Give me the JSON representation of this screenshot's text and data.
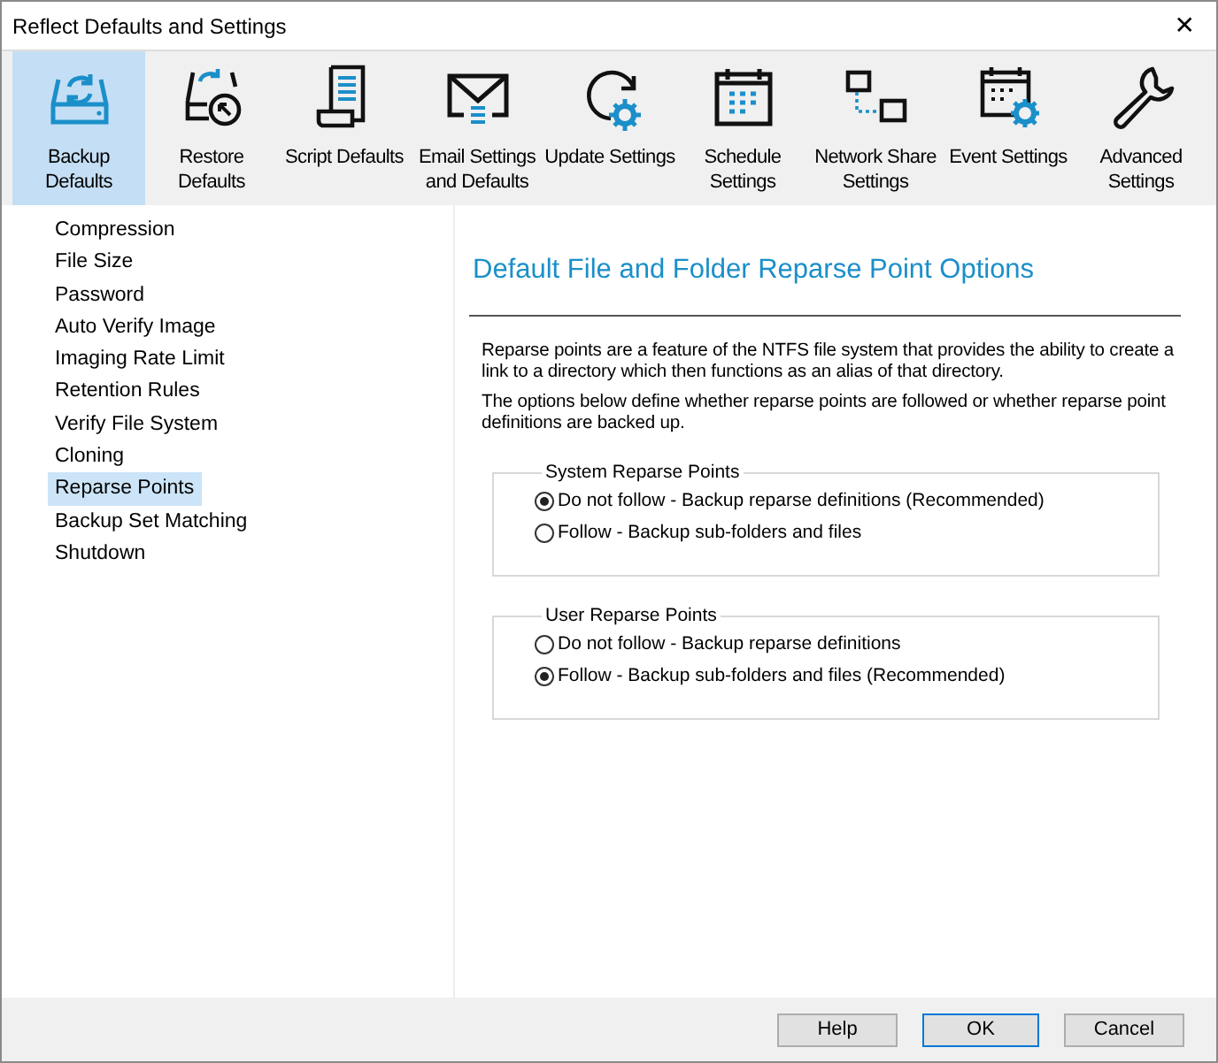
{
  "window": {
    "title": "Reflect Defaults and Settings",
    "close": "✕"
  },
  "toolbar": [
    {
      "label": "Backup Defaults",
      "selected": true
    },
    {
      "label": "Restore Defaults",
      "selected": false
    },
    {
      "label": "Script Defaults",
      "selected": false
    },
    {
      "label": "Email Settings and Defaults",
      "selected": false
    },
    {
      "label": "Update Settings",
      "selected": false
    },
    {
      "label": "Schedule Settings",
      "selected": false
    },
    {
      "label": "Network Share Settings",
      "selected": false
    },
    {
      "label": "Event Settings",
      "selected": false
    },
    {
      "label": "Advanced Settings",
      "selected": false
    }
  ],
  "sidebar": {
    "items": [
      {
        "label": "Compression",
        "selected": false
      },
      {
        "label": "File Size",
        "selected": false
      },
      {
        "label": "Password",
        "selected": false
      },
      {
        "label": "Auto Verify Image",
        "selected": false
      },
      {
        "label": "Imaging Rate Limit",
        "selected": false
      },
      {
        "label": "Retention Rules",
        "selected": false
      },
      {
        "label": "Verify File System",
        "selected": false
      },
      {
        "label": "Cloning",
        "selected": false
      },
      {
        "label": "Reparse Points",
        "selected": true
      },
      {
        "label": "Backup Set Matching",
        "selected": false
      },
      {
        "label": "Shutdown",
        "selected": false
      }
    ]
  },
  "content": {
    "heading": "Default File and Folder Reparse Point Options",
    "paragraphs": [
      "Reparse points are a feature of the NTFS file system that provides the ability to create a link to a directory which then functions as an alias of that directory.",
      "The options below  define whether reparse points are followed or whether reparse point definitions are backed up."
    ],
    "groups": [
      {
        "title": "System Reparse Points",
        "options": [
          {
            "label": "Do not follow - Backup reparse definitions (Recommended)",
            "selected": true
          },
          {
            "label": "Follow - Backup sub-folders and files",
            "selected": false
          }
        ]
      },
      {
        "title": "User Reparse Points",
        "options": [
          {
            "label": "Do not follow - Backup reparse definitions",
            "selected": false
          },
          {
            "label": "Follow - Backup sub-folders and files (Recommended)",
            "selected": true
          }
        ]
      }
    ]
  },
  "buttons": [
    {
      "label": "Help",
      "default": false
    },
    {
      "label": "OK",
      "default": true
    },
    {
      "label": "Cancel",
      "default": false
    }
  ]
}
